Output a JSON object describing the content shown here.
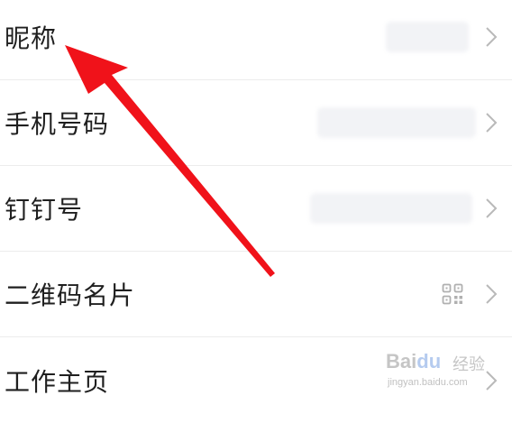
{
  "profile": {
    "rows": [
      {
        "label": "昵称",
        "value_visible": false
      },
      {
        "label": "手机号码",
        "value_visible": false
      },
      {
        "label": "钉钉号",
        "value_visible": false
      },
      {
        "label": "二维码名片",
        "icon": "qr-code-icon"
      },
      {
        "label": "工作主页"
      }
    ]
  },
  "watermark": {
    "brand_a": "Bai",
    "brand_b": "du",
    "suffix": "经验",
    "url": "jingyan.baidu.com"
  },
  "colors": {
    "annotation_arrow": "#f0121a",
    "text": "#1f1f1f",
    "chevron": "#b9b9b9",
    "divider": "#ececec"
  }
}
